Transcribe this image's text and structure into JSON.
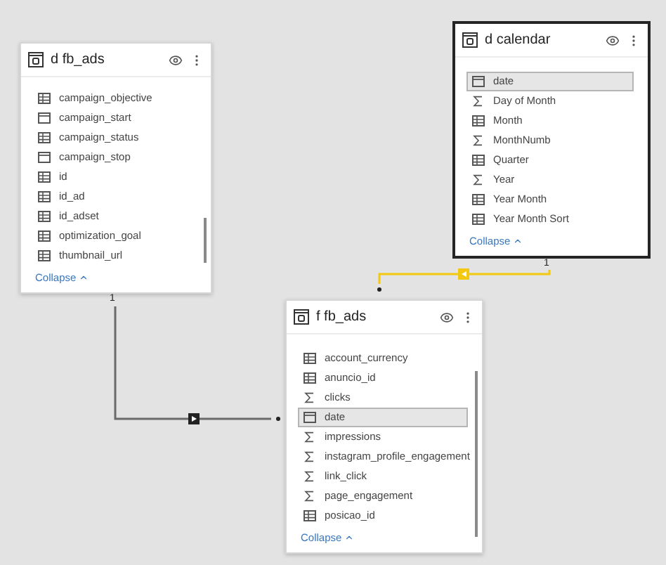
{
  "tables": [
    {
      "title": "d fb_ads",
      "selected": false,
      "collapse": "Collapse",
      "fields": [
        {
          "name": "campaign_objective",
          "kind": "column",
          "selected": false
        },
        {
          "name": "campaign_start",
          "kind": "date",
          "selected": false
        },
        {
          "name": "campaign_status",
          "kind": "column",
          "selected": false
        },
        {
          "name": "campaign_stop",
          "kind": "date",
          "selected": false
        },
        {
          "name": "id",
          "kind": "column",
          "selected": false
        },
        {
          "name": "id_ad",
          "kind": "column",
          "selected": false
        },
        {
          "name": "id_adset",
          "kind": "column",
          "selected": false
        },
        {
          "name": "optimization_goal",
          "kind": "column",
          "selected": false
        },
        {
          "name": "thumbnail_url",
          "kind": "column",
          "selected": false
        }
      ]
    },
    {
      "title": "d calendar",
      "selected": true,
      "collapse": "Collapse",
      "fields": [
        {
          "name": "date",
          "kind": "date",
          "selected": true
        },
        {
          "name": "Day of Month",
          "kind": "sum",
          "selected": false
        },
        {
          "name": "Month",
          "kind": "column",
          "selected": false
        },
        {
          "name": "MonthNumb",
          "kind": "sum",
          "selected": false
        },
        {
          "name": "Quarter",
          "kind": "column",
          "selected": false
        },
        {
          "name": "Year",
          "kind": "sum",
          "selected": false
        },
        {
          "name": "Year Month",
          "kind": "column",
          "selected": false
        },
        {
          "name": "Year Month Sort",
          "kind": "column",
          "selected": false
        }
      ]
    },
    {
      "title": "f fb_ads",
      "selected": false,
      "collapse": "Collapse",
      "fields": [
        {
          "name": "account_currency",
          "kind": "column",
          "selected": false
        },
        {
          "name": "anuncio_id",
          "kind": "column",
          "selected": false
        },
        {
          "name": "clicks",
          "kind": "sum",
          "selected": false
        },
        {
          "name": "date",
          "kind": "date",
          "selected": true
        },
        {
          "name": "impressions",
          "kind": "sum",
          "selected": false
        },
        {
          "name": "instagram_profile_engagement",
          "kind": "sum",
          "selected": false
        },
        {
          "name": "link_click",
          "kind": "sum",
          "selected": false
        },
        {
          "name": "page_engagement",
          "kind": "sum",
          "selected": false
        },
        {
          "name": "posicao_id",
          "kind": "column",
          "selected": false
        }
      ]
    }
  ],
  "relationships": [
    {
      "label": "1",
      "active": false
    },
    {
      "label": "1",
      "active": true
    }
  ]
}
